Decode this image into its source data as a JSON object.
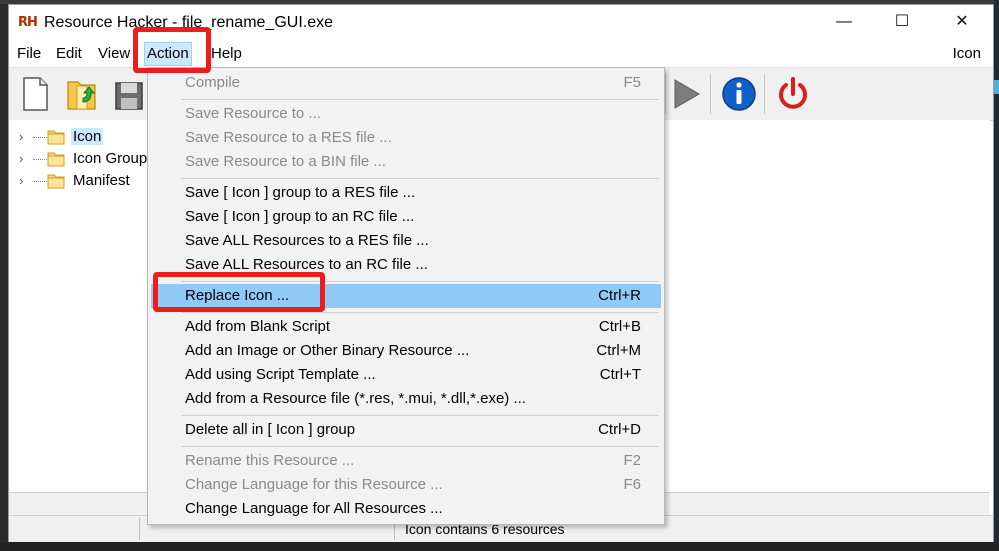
{
  "window": {
    "logo": "RH",
    "title": "Resource Hacker - file_rename_GUI.exe",
    "controls": {
      "minimize": "—",
      "maximize": "☐",
      "close": "✕"
    }
  },
  "menubar": {
    "items": [
      "File",
      "Edit",
      "View",
      "Action",
      "Help"
    ],
    "active": "Action",
    "right_label": "Icon"
  },
  "toolbar": {
    "buttons": [
      "new-file-icon",
      "open-folder-icon",
      "save-icon",
      "run-icon",
      "info-icon",
      "exit-power-icon"
    ]
  },
  "tree": {
    "items": [
      {
        "label": "Icon",
        "selected": true
      },
      {
        "label": "Icon Group",
        "selected": false
      },
      {
        "label": "Manifest",
        "selected": false
      }
    ]
  },
  "action_menu": {
    "items": [
      {
        "label": "Compile",
        "shortcut": "F5",
        "disabled": true
      },
      {
        "label": "Save Resource to ...",
        "shortcut": "",
        "disabled": true
      },
      {
        "label": "Save Resource to a RES file ...",
        "shortcut": "",
        "disabled": true
      },
      {
        "label": "Save Resource to a BIN file ...",
        "shortcut": "",
        "disabled": true
      },
      {
        "label": "Save [ Icon ] group to a RES file ...",
        "shortcut": "",
        "disabled": false
      },
      {
        "label": "Save [ Icon ] group to an RC file ...",
        "shortcut": "",
        "disabled": false
      },
      {
        "label": "Save ALL Resources to a RES file ...",
        "shortcut": "",
        "disabled": false
      },
      {
        "label": "Save ALL Resources to an RC file ...",
        "shortcut": "",
        "disabled": false
      },
      {
        "label": "Replace Icon ...",
        "shortcut": "Ctrl+R",
        "disabled": false,
        "highlighted": true
      },
      {
        "label": "Add from Blank Script",
        "shortcut": "Ctrl+B",
        "disabled": false
      },
      {
        "label": "Add an Image or Other Binary Resource ...",
        "shortcut": "Ctrl+M",
        "disabled": false
      },
      {
        "label": "Add using Script Template ...",
        "shortcut": "Ctrl+T",
        "disabled": false
      },
      {
        "label": "Add from a Resource file (*.res, *.mui, *.dll,*.exe) ...",
        "shortcut": "",
        "disabled": false
      },
      {
        "label": "Delete all in [ Icon ] group",
        "shortcut": "Ctrl+D",
        "disabled": false
      },
      {
        "label": "Rename this Resource ...",
        "shortcut": "F2",
        "disabled": true
      },
      {
        "label": "Change Language for this Resource ...",
        "shortcut": "F6",
        "disabled": true
      },
      {
        "label": "Change Language for All Resources ...",
        "shortcut": "",
        "disabled": false
      }
    ]
  },
  "statusbar": {
    "text": "Icon contains 6 resources"
  },
  "colors": {
    "highlight": "#91c9f7",
    "menu_active": "#cce8ff",
    "annotation": "#ee1c1c",
    "info_blue": "#1060c8",
    "power_red": "#d81e1e"
  }
}
